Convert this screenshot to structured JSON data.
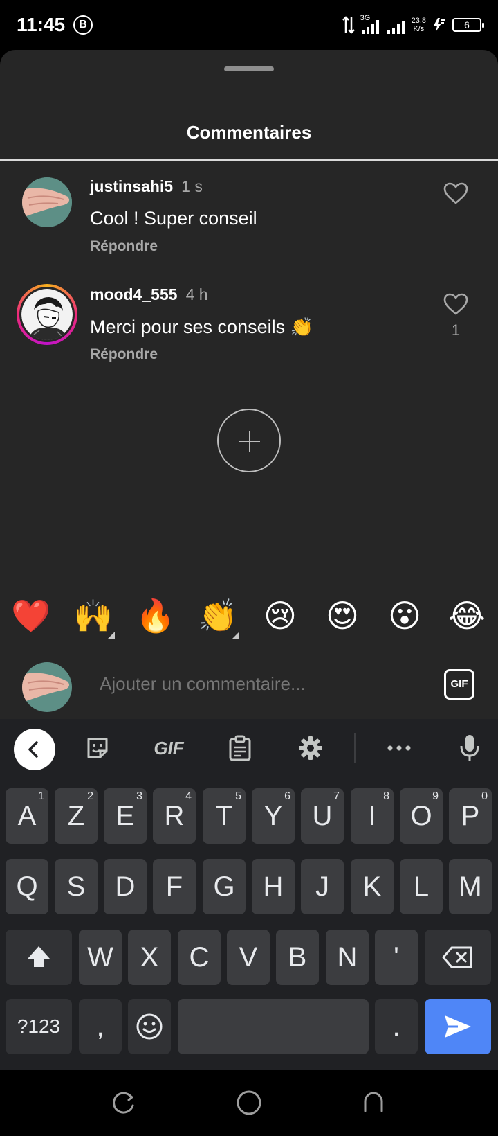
{
  "status_bar": {
    "time": "11:45",
    "b_icon": "B",
    "network_type": "3G",
    "speed_value": "23,8",
    "speed_unit": "K/s",
    "battery": "6"
  },
  "sheet": {
    "title": "Commentaires"
  },
  "comments": [
    {
      "username": "justinsahi5",
      "time": "1 s",
      "text": "Cool ! Super conseil",
      "reply_label": "Répondre",
      "likes": ""
    },
    {
      "username": "mood4_555",
      "time": "4 h",
      "text": "Merci pour ses conseils 👏",
      "reply_label": "Répondre",
      "likes": "1"
    }
  ],
  "emoji_bar": [
    "❤️",
    "🙌",
    "🔥",
    "👏",
    "😢",
    "😍",
    "😮",
    "😂"
  ],
  "comment_input": {
    "placeholder": "Ajouter un commentaire...",
    "gif_label": "GIF"
  },
  "keyboard": {
    "toolbar": {
      "gif_label": "GIF"
    },
    "row1": [
      {
        "key": "A",
        "hint": "1"
      },
      {
        "key": "Z",
        "hint": "2"
      },
      {
        "key": "E",
        "hint": "3"
      },
      {
        "key": "R",
        "hint": "4"
      },
      {
        "key": "T",
        "hint": "5"
      },
      {
        "key": "Y",
        "hint": "6"
      },
      {
        "key": "U",
        "hint": "7"
      },
      {
        "key": "I",
        "hint": "8"
      },
      {
        "key": "O",
        "hint": "9"
      },
      {
        "key": "P",
        "hint": "0"
      }
    ],
    "row2": [
      "Q",
      "S",
      "D",
      "F",
      "G",
      "H",
      "J",
      "K",
      "L",
      "M"
    ],
    "row3": [
      "W",
      "X",
      "C",
      "V",
      "B",
      "N",
      "'"
    ],
    "row4": {
      "symbols": "?123",
      "comma": ",",
      "period": "."
    }
  }
}
